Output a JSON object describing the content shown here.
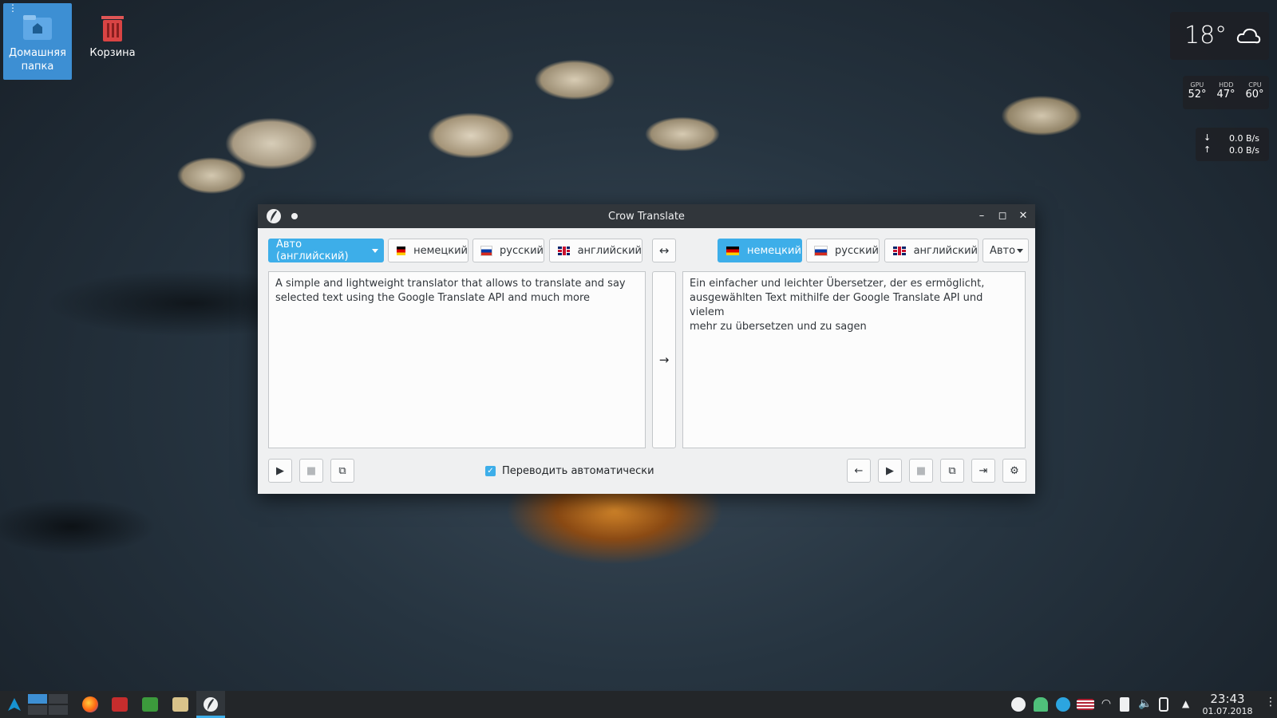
{
  "desktop": {
    "icons": [
      {
        "label": "Домашняя папка"
      },
      {
        "label": "Корзина"
      }
    ]
  },
  "widgets": {
    "weather": {
      "temperature": "18°"
    },
    "sensors": {
      "labels": [
        "GPU",
        "HDD",
        "CPU"
      ],
      "values": [
        "52°",
        "47°",
        "60°"
      ]
    },
    "network": {
      "download": "0.0 B/s",
      "upload": "0.0 B/s"
    }
  },
  "window": {
    "title": "Crow Translate",
    "source_langs": [
      "Авто (английский)",
      "немецкий",
      "русский",
      "английский"
    ],
    "target_langs": [
      "немецкий",
      "русский",
      "английский",
      "Авто"
    ],
    "source_text": "A simple and lightweight translator that allows to translate and say\nselected text using the Google Translate API and much more",
    "translation_text": "Ein einfacher und leichter Übersetzer, der es ermöglicht,\nausgewählten Text mithilfe der Google Translate API und vielem\nmehr zu übersetzen und zu sagen",
    "auto_translate_label": "Переводить автоматически",
    "auto_translate_checked": true
  },
  "taskbar": {
    "time": "23:43",
    "date": "01.07.2018"
  },
  "colors": {
    "accent": "#3daee9",
    "titlebar": "#31363b",
    "taskbar": "#232629"
  }
}
